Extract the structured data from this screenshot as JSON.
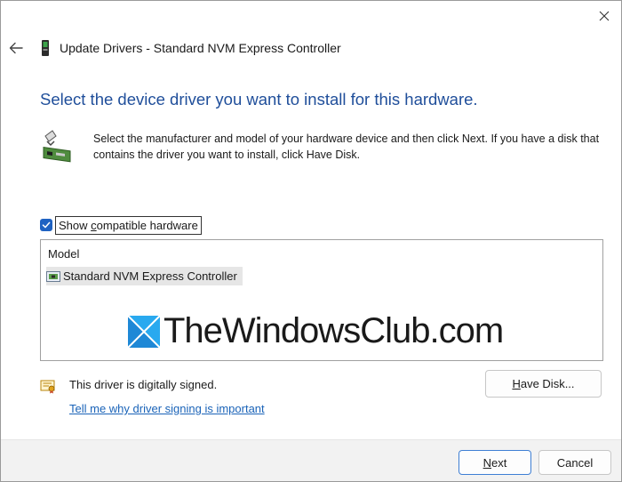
{
  "window": {
    "title": "Update Drivers - Standard NVM Express Controller"
  },
  "heading": "Select the device driver you want to install for this hardware.",
  "instructions": "Select the manufacturer and model of your hardware device and then click Next. If you have a disk that contains the driver you want to install, click Have Disk.",
  "compatible": {
    "checked": true,
    "label_prefix": "Show ",
    "label_accel": "c",
    "label_rest": "ompatible hardware"
  },
  "model_list": {
    "header": "Model",
    "items": [
      {
        "label": "Standard NVM Express Controller",
        "selected": true
      }
    ]
  },
  "watermark": {
    "text": "TheWindowsClub.com"
  },
  "signing": {
    "status": "This driver is digitally signed.",
    "link": "Tell me why driver signing is important"
  },
  "buttons": {
    "have_disk_accel": "H",
    "have_disk_rest": "ave Disk...",
    "next_accel": "N",
    "next_rest": "ext",
    "cancel": "Cancel"
  },
  "icons": {
    "close": "close-icon",
    "back": "back-arrow-icon",
    "title": "device-icon",
    "hardware": "hardware-device-icon",
    "certificate": "certificate-icon",
    "watermark": "windows-logo-icon"
  },
  "colors": {
    "accent": "#1f62c2",
    "heading": "#1f4e9a",
    "link": "#1a63b8"
  }
}
